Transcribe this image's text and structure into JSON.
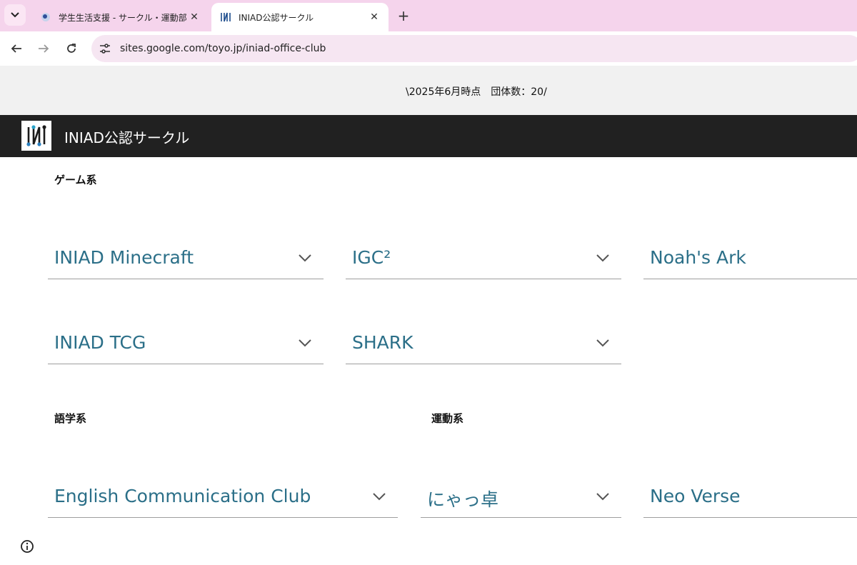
{
  "browser": {
    "tabs": [
      {
        "title": "学生生活支援 - サークル・運動部活動"
      },
      {
        "title": "INIAD公認サークル"
      }
    ],
    "url": "sites.google.com/toyo.jp/iniad-office-club"
  },
  "banner": {
    "text": "\\2025年6月時点　団体数：20/"
  },
  "site": {
    "title": "INIAD公認サークル"
  },
  "sections": {
    "game": {
      "label": "ゲーム系",
      "items": [
        "INIAD Minecraft",
        "IGC²",
        "Noah's Ark",
        "INIAD TCG",
        "SHARK"
      ]
    },
    "language": {
      "label": "語学系",
      "items": [
        "English Communication Club"
      ]
    },
    "sports": {
      "label": "運動系",
      "items": [
        "にゃっ卓",
        "Neo Verse"
      ]
    }
  },
  "colors": {
    "accent": "#2b6f88",
    "header_bg": "#212121",
    "tabstrip_bg": "#f5d4ec"
  }
}
